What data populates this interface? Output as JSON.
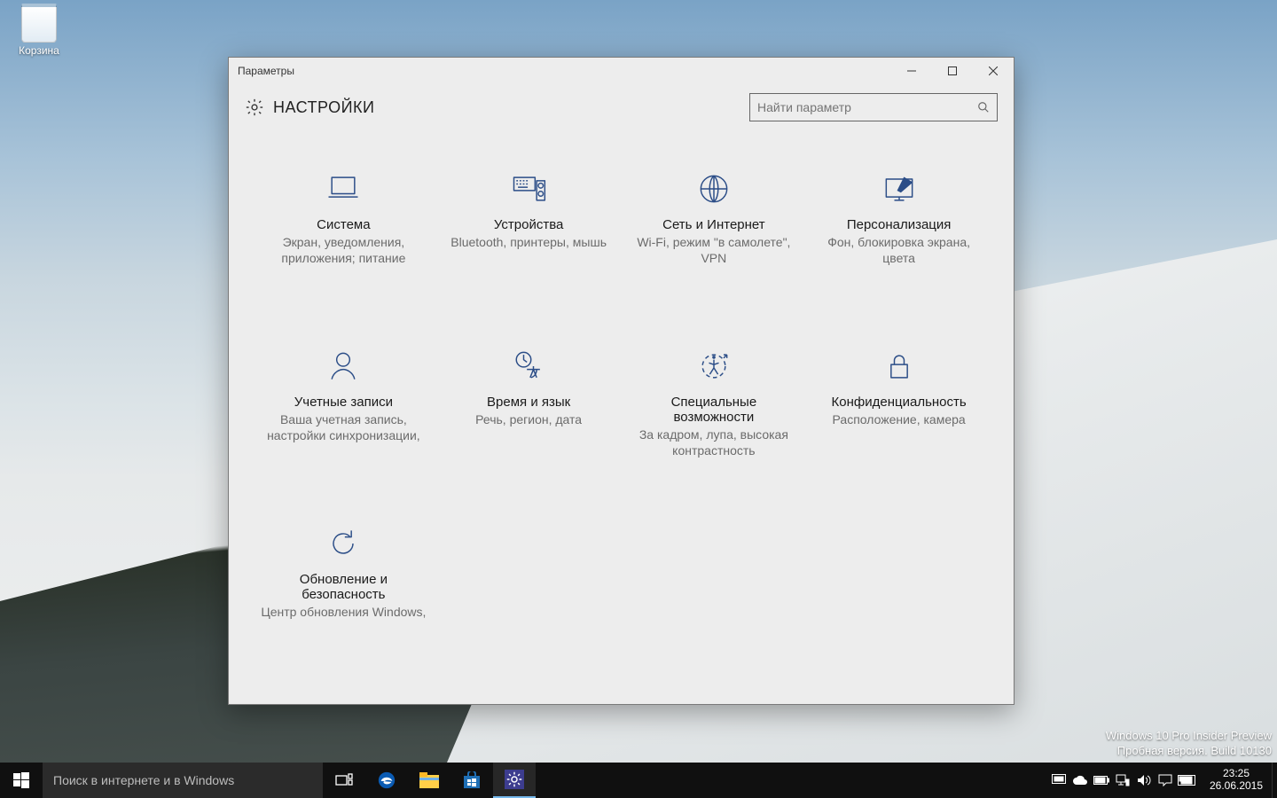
{
  "desktop": {
    "recycle_bin_label": "Корзина"
  },
  "watermark": {
    "line1": "Windows 10 Pro Insider Preview",
    "line2": "Пробная версия. Build 10130"
  },
  "window": {
    "title": "Параметры",
    "heading": "НАСТРОЙКИ",
    "search_placeholder": "Найти параметр"
  },
  "categories": [
    {
      "id": "system",
      "icon": "laptop-icon",
      "title": "Система",
      "desc": "Экран, уведомления, приложения; питание"
    },
    {
      "id": "devices",
      "icon": "devices-icon",
      "title": "Устройства",
      "desc": "Bluetooth, принтеры, мышь"
    },
    {
      "id": "network",
      "icon": "globe-icon",
      "title": "Сеть и Интернет",
      "desc": "Wi-Fi, режим \"в самолете\", VPN"
    },
    {
      "id": "personalization",
      "icon": "personalization-icon",
      "title": "Персонализация",
      "desc": "Фон, блокировка экрана, цвета"
    },
    {
      "id": "accounts",
      "icon": "person-icon",
      "title": "Учетные записи",
      "desc": "Ваша учетная запись, настройки синхронизации,"
    },
    {
      "id": "time-language",
      "icon": "time-language-icon",
      "title": "Время и язык",
      "desc": "Речь, регион, дата"
    },
    {
      "id": "ease-of-access",
      "icon": "ease-of-access-icon",
      "title": "Специальные возможности",
      "desc": "За кадром, лупа, высокая контрастность"
    },
    {
      "id": "privacy",
      "icon": "lock-icon",
      "title": "Конфиденциальность",
      "desc": "Расположение, камера"
    },
    {
      "id": "update-security",
      "icon": "update-icon",
      "title": "Обновление и безопасность",
      "desc": "Центр обновления Windows,"
    }
  ],
  "taskbar": {
    "search_placeholder": "Поиск в интернете и в Windows",
    "clock_time": "23:25",
    "clock_date": "26.06.2015"
  }
}
